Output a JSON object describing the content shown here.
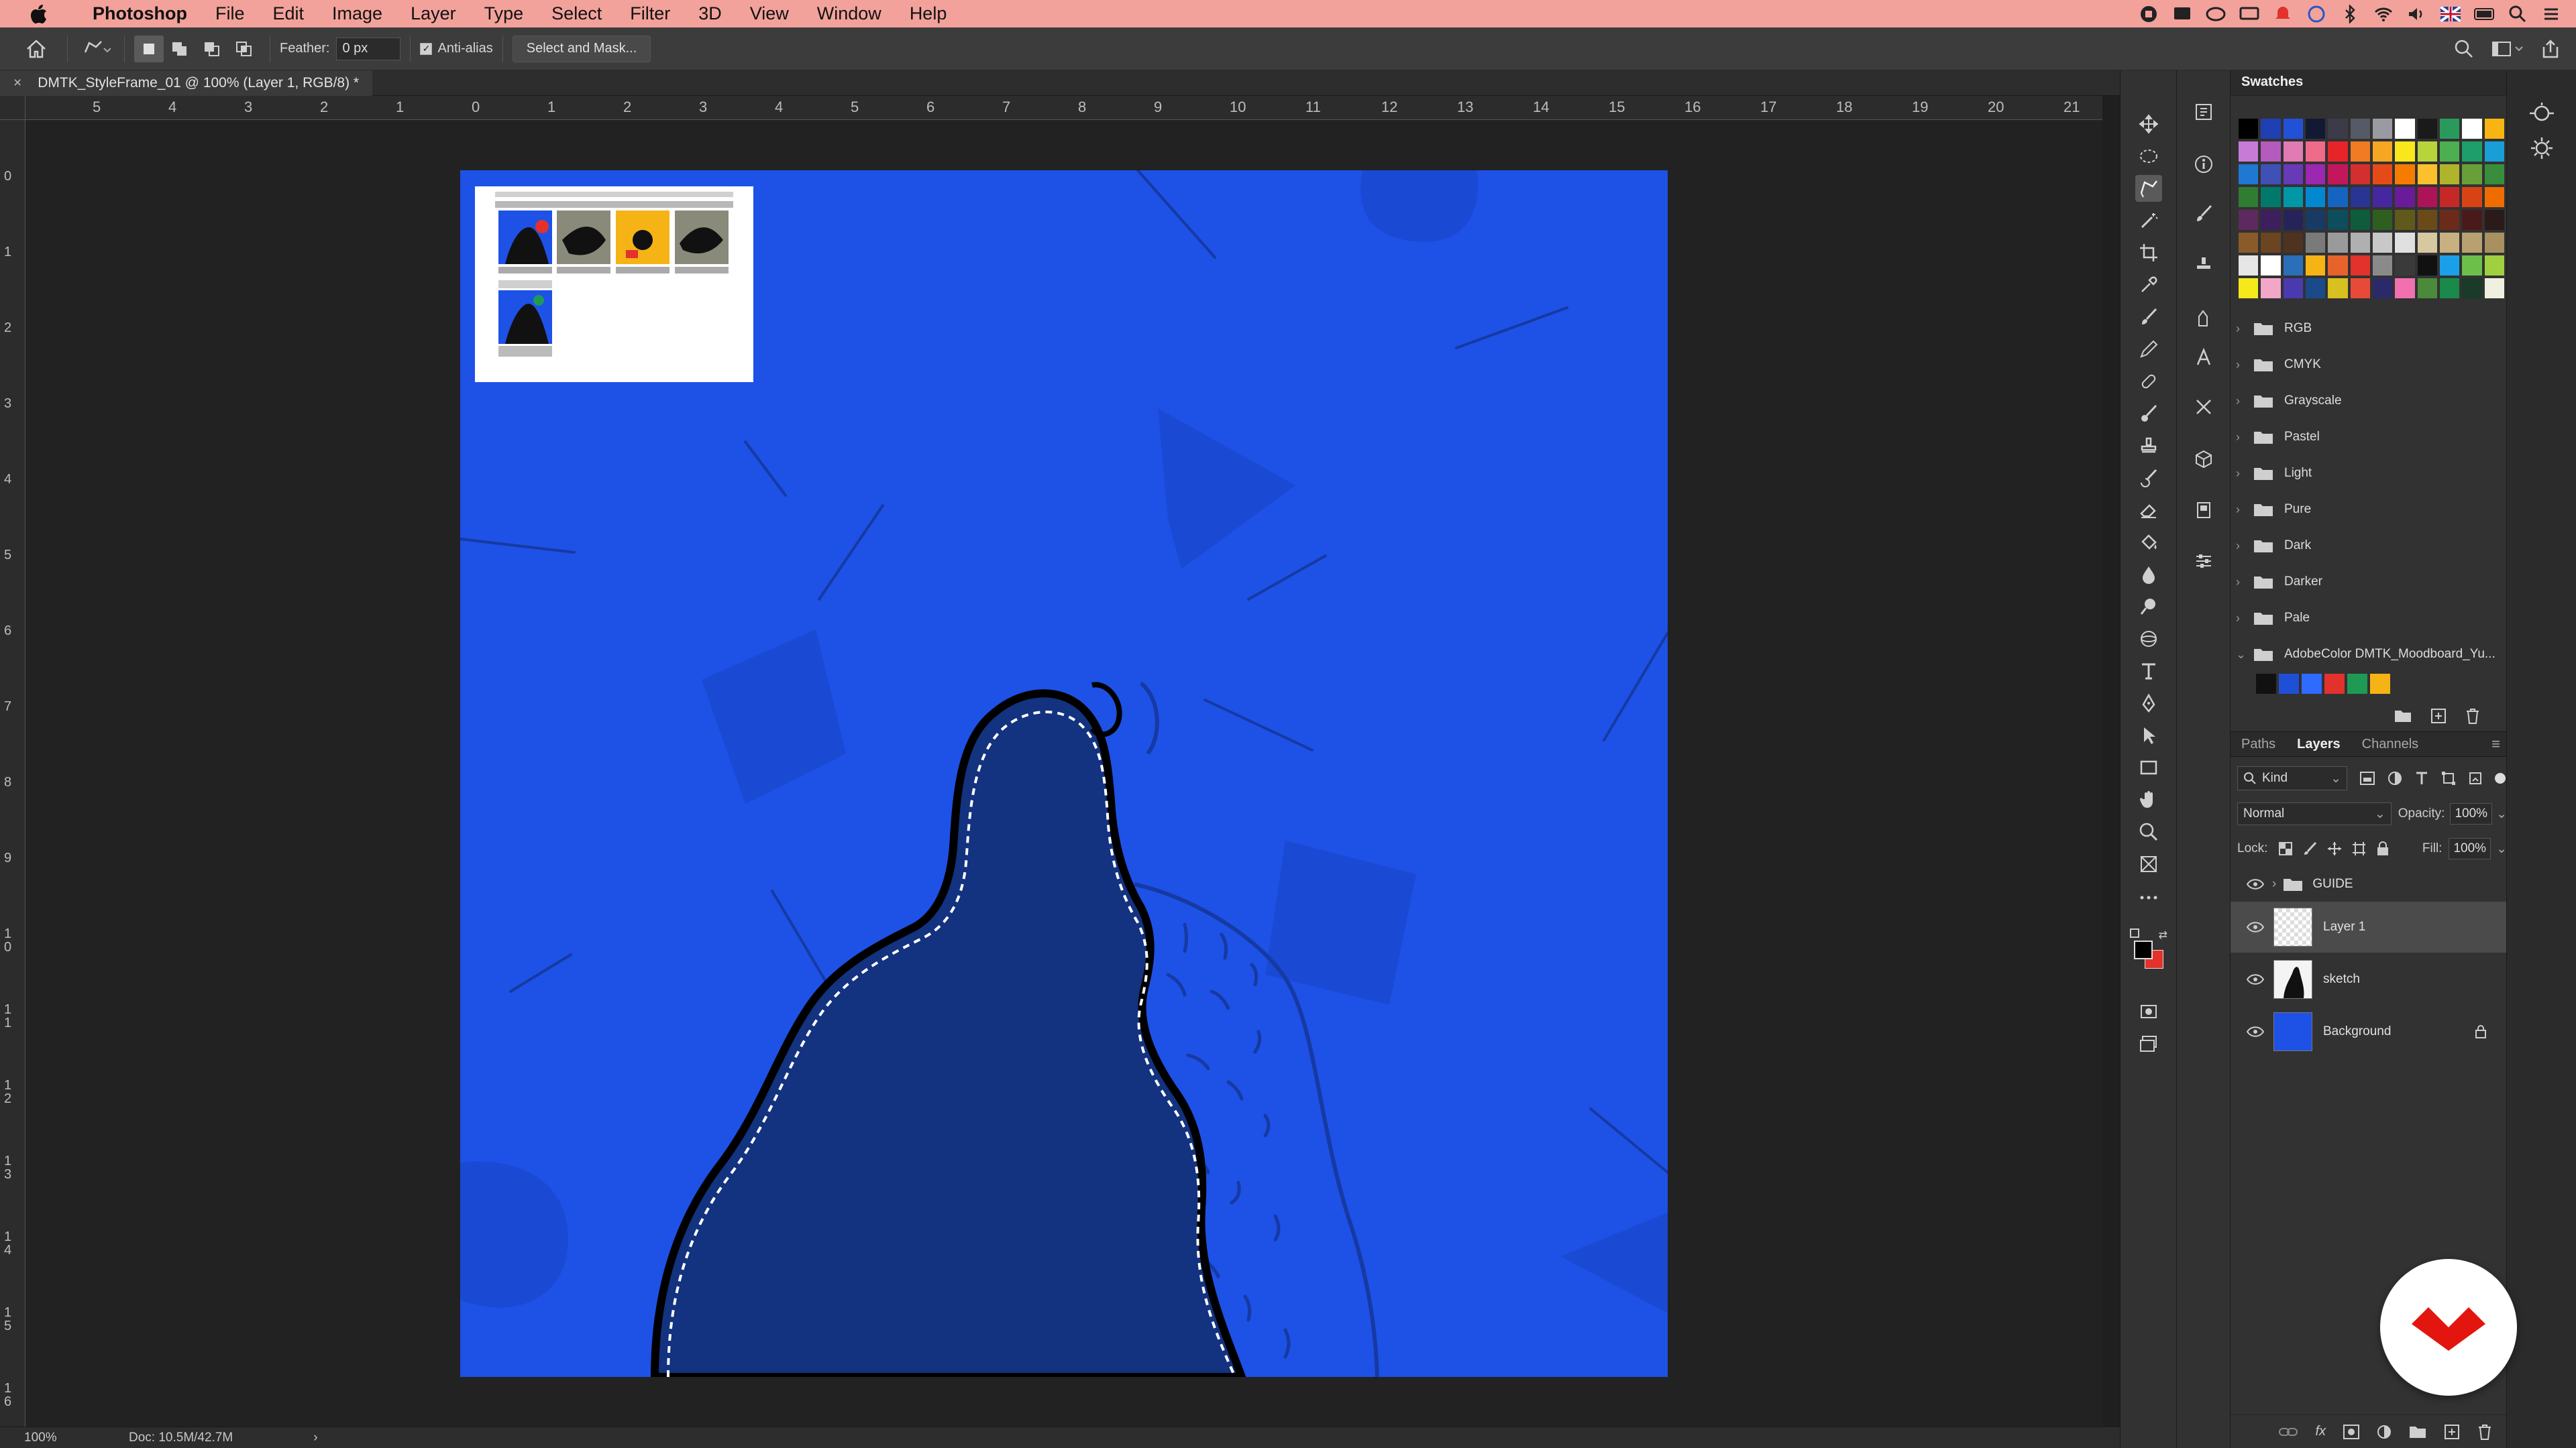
{
  "menubar": {
    "app_name": "Photoshop",
    "items": [
      "File",
      "Edit",
      "Image",
      "Layer",
      "Type",
      "Select",
      "Filter",
      "3D",
      "View",
      "Window",
      "Help"
    ]
  },
  "options_bar": {
    "feather_label": "Feather:",
    "feather_value": "0 px",
    "anti_alias_label": "Anti-alias",
    "anti_alias_checked": true,
    "select_mask_label": "Select and Mask..."
  },
  "document": {
    "tab_title": "DMTK_StyleFrame_01 @ 100% (Layer 1, RGB/8) *",
    "close_glyph": "×"
  },
  "rulers": {
    "top_labels": [
      "5",
      "4",
      "3",
      "2",
      "1",
      "0",
      "1",
      "2",
      "3",
      "4",
      "5",
      "6",
      "7",
      "8",
      "9",
      "10",
      "11",
      "12",
      "13",
      "14",
      "15",
      "16",
      "17",
      "18",
      "19",
      "20",
      "21"
    ],
    "left_labels": [
      "0",
      "1",
      "2",
      "3",
      "4",
      "5",
      "6",
      "7",
      "8",
      "9",
      "10",
      "11",
      "12",
      "13",
      "14",
      "15",
      "16"
    ]
  },
  "status_bar": {
    "zoom": "100%",
    "doc_info": "Doc: 10.5M/42.7M",
    "arrow": "›"
  },
  "swatches_panel": {
    "title": "Swatches",
    "folders": [
      "RGB",
      "CMYK",
      "Grayscale",
      "Pastel",
      "Light",
      "Pure",
      "Dark",
      "Darker",
      "Pale"
    ],
    "expanded_group": "AdobeColor DMTK_Moodboard_Yu...",
    "expanded_colors": [
      "#111111",
      "#1f4fd6",
      "#2f6bff",
      "#e2322b",
      "#1f9a55",
      "#f5b316"
    ],
    "grid_rows": [
      [
        "#000000",
        "#1f3fb3",
        "#2251d8",
        "#121a33",
        "#3b3b4a",
        "#555a66",
        "#9a9aa2",
        "#ffffff",
        "#1a1a1a",
        "#2a9a5c",
        "#ffffff",
        "#f7b413"
      ],
      [
        "#c87bd6",
        "#b45bbd",
        "#e07bb4",
        "#f06a8a",
        "#e8242b",
        "#f07b22",
        "#f5a623",
        "#f8e71c",
        "#b8d43b",
        "#4caf50",
        "#1e9e6a",
        "#1a9ed8"
      ],
      [
        "#1f78d1",
        "#3f51b5",
        "#673ab7",
        "#9c27b0",
        "#c2185b",
        "#d32f2f",
        "#e64a19",
        "#f57c00",
        "#fbc02d",
        "#afb42b",
        "#689f38",
        "#388e3c"
      ],
      [
        "#2e7d32",
        "#00796b",
        "#0097a7",
        "#0288d1",
        "#1565c0",
        "#283593",
        "#4527a0",
        "#6a1b9a",
        "#ad1457",
        "#c62828",
        "#d84315",
        "#ef6c00"
      ],
      [
        "#5d2a5f",
        "#3d1f5e",
        "#26235a",
        "#1a3a66",
        "#0d4d5c",
        "#0f5c3d",
        "#2e5f1f",
        "#5f5a1a",
        "#6b4a1a",
        "#6b2a1a",
        "#4a1a1a",
        "#2a1a1a"
      ],
      [
        "#8a5a2a",
        "#6b4422",
        "#4e3320",
        "#7a7a7a",
        "#9a9a9a",
        "#b0b0b0",
        "#c8c8c8",
        "#e0e0e0",
        "#d8c8a0",
        "#c8b080",
        "#b8a070",
        "#a89060"
      ],
      [
        "#e6e6e6",
        "#ffffff",
        "#2b6fb8",
        "#f5b316",
        "#e8632b",
        "#e2322b",
        "#8a8a8a",
        "#3a3a3a",
        "#111111",
        "#1aa0e8",
        "#6cc04a",
        "#a0d040"
      ],
      [
        "#f5e91c",
        "#f2a6c8",
        "#4a3ab0",
        "#1a4a8a",
        "#d8c020",
        "#e84a3a",
        "#2a2a6a",
        "#f070b0",
        "#4a8a3a",
        "#1a8a4a",
        "#1a3a2a",
        "#f0f0e0"
      ]
    ]
  },
  "layers_panel": {
    "tabs": [
      "Paths",
      "Layers",
      "Channels"
    ],
    "active_tab": "Layers",
    "filter_kind": "Kind",
    "blend_mode": "Normal",
    "opacity_label": "Opacity:",
    "opacity_value": "100%",
    "lock_label": "Lock:",
    "fill_label": "Fill:",
    "fill_value": "100%",
    "layers": [
      {
        "name": "GUIDE",
        "type": "group",
        "visible": true,
        "selected": false
      },
      {
        "name": "Layer 1",
        "type": "layer",
        "visible": true,
        "selected": true
      },
      {
        "name": "sketch",
        "type": "layer",
        "visible": true,
        "selected": false
      },
      {
        "name": "Background",
        "type": "background",
        "visible": true,
        "selected": false,
        "locked": true
      }
    ]
  },
  "colors": {
    "menubar_bg": "#f2a29b",
    "artboard_blue": "#1e51e6",
    "shape_navy": "#13327f",
    "foreground": "#000000",
    "background": "#e2322b",
    "logo_red": "#e3150f"
  }
}
